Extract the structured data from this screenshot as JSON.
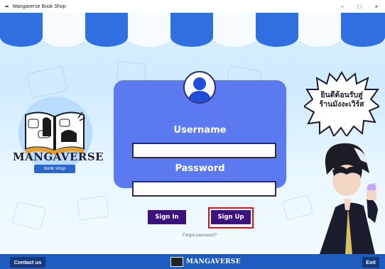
{
  "window": {
    "title": "Mangaverse Book Shop",
    "minimize": "–",
    "maximize": "□",
    "close": "×"
  },
  "logo": {
    "title": "MANGAVERSE",
    "subtitle": "book shop"
  },
  "login": {
    "username_label": "Username",
    "username_value": "",
    "password_label": "Password",
    "password_value": "",
    "signin_label": "Sign In",
    "signup_label": "Sign Up",
    "forgot_label": "Forgot password?"
  },
  "promo": {
    "line1": "ยินดีต้อนรับสู่",
    "line2": "ร้านมังงะเวิร์ส"
  },
  "footer": {
    "contact_label": "Contact us",
    "brand": "MANGAVERSE",
    "exit_label": "Exit"
  },
  "colors": {
    "card": "#5b79f1",
    "button": "#3a1279",
    "footer": "#1f5cbf",
    "highlight": "#e01010",
    "awning": "#2f6fe0"
  }
}
